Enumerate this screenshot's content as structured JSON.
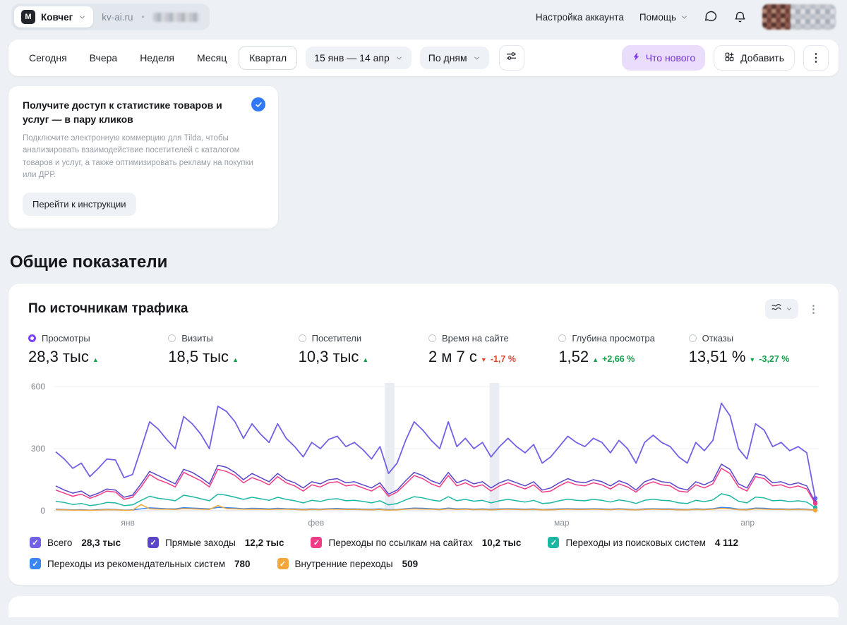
{
  "header": {
    "counter_name": "Ковчег",
    "site_domain": "kv-ai.ru",
    "separator": "•",
    "account_settings_label": "Настройка аккаунта",
    "help_label": "Помощь"
  },
  "glyphs": {
    "kebab": "⋮",
    "check": "✓"
  },
  "toolbar": {
    "periods": [
      "Сегодня",
      "Вчера",
      "Неделя",
      "Месяц",
      "Квартал"
    ],
    "selected_period": "Квартал",
    "date_range_label": "15 янв — 14 апр",
    "granularity_label": "По дням",
    "whats_new_label": "Что нового",
    "add_label": "Добавить"
  },
  "promo": {
    "title": "Получите доступ к статистике товаров и услуг — в пару кликов",
    "body": "Подключите электронную коммерцию для Tilda, чтобы анализировать взаимодействие посетителей с каталогом товаров и услуг, а также оптимизировать рекламу на покупки или ДРР.",
    "action_label": "Перейти к инструкции"
  },
  "section_title": "Общие показатели",
  "chart_card": {
    "title": "По источникам трафика",
    "metrics": [
      {
        "label": "Просмотры",
        "value": "28,3 тыс",
        "trend": "up",
        "trend_color": "green",
        "delta": "",
        "selected": true
      },
      {
        "label": "Визиты",
        "value": "18,5 тыс",
        "trend": "up",
        "trend_color": "green",
        "delta": ""
      },
      {
        "label": "Посетители",
        "value": "10,3 тыс",
        "trend": "up",
        "trend_color": "green",
        "delta": ""
      },
      {
        "label": "Время на сайте",
        "value": "2 м 7 с",
        "trend": "down",
        "trend_color": "red",
        "delta": "-1,7 %"
      },
      {
        "label": "Глубина просмотра",
        "value": "1,52",
        "trend": "up",
        "trend_color": "green",
        "delta": "+2,66 %"
      },
      {
        "label": "Отказы",
        "value": "13,51 %",
        "trend": "down",
        "trend_color": "green",
        "delta": "-3,27 %"
      }
    ],
    "legend": [
      {
        "label": "Всего",
        "value": "28,3 тыс"
      },
      {
        "label": "Прямые заходы",
        "value": "12,2 тыс"
      },
      {
        "label": "Переходы по ссылкам на сайтах",
        "value": "10,2 тыс"
      },
      {
        "label": "Переходы из поисковых систем",
        "value": "4 112"
      },
      {
        "label": "Переходы из рекомендательных систем",
        "value": "780"
      },
      {
        "label": "Внутренние переходы",
        "value": "509"
      }
    ]
  },
  "chart_data": {
    "type": "line",
    "title": "По источникам трафика",
    "metric_shown": "Просмотры",
    "date_range": "15 янв — 14 апр",
    "granularity": "По дням",
    "y_axis": {
      "ticks": [
        0,
        300,
        600
      ],
      "max": 600
    },
    "x_axis": {
      "ticks": [
        "янв",
        "фев",
        "мар",
        "апр"
      ],
      "tick_fractions": [
        0.097,
        0.343,
        0.664,
        0.907
      ]
    },
    "highlight_band_fractions": [
      0.439,
      0.576
    ],
    "series": [
      {
        "name": "Всего",
        "total": "28,3 тыс",
        "color": "#7161e6",
        "values": [
          285,
          250,
          205,
          230,
          165,
          205,
          250,
          245,
          160,
          175,
          300,
          430,
          395,
          345,
          300,
          455,
          420,
          370,
          300,
          505,
          480,
          430,
          350,
          420,
          370,
          330,
          420,
          350,
          310,
          260,
          330,
          300,
          345,
          360,
          310,
          330,
          295,
          250,
          310,
          180,
          230,
          340,
          430,
          390,
          340,
          300,
          430,
          310,
          350,
          300,
          330,
          260,
          310,
          350,
          310,
          280,
          320,
          230,
          260,
          310,
          360,
          330,
          310,
          350,
          330,
          280,
          340,
          300,
          230,
          330,
          365,
          330,
          310,
          260,
          230,
          330,
          290,
          340,
          520,
          460,
          300,
          250,
          420,
          390,
          310,
          330,
          290,
          310,
          280,
          60
        ]
      },
      {
        "name": "Прямые заходы",
        "total": "12,2 тыс",
        "color": "#5b45c9",
        "values": [
          120,
          100,
          85,
          95,
          70,
          85,
          105,
          100,
          65,
          75,
          130,
          190,
          170,
          150,
          130,
          200,
          185,
          160,
          130,
          220,
          210,
          185,
          150,
          180,
          160,
          140,
          180,
          150,
          135,
          110,
          140,
          130,
          150,
          155,
          135,
          140,
          125,
          110,
          135,
          80,
          100,
          145,
          185,
          170,
          145,
          130,
          185,
          135,
          150,
          130,
          140,
          110,
          135,
          150,
          135,
          120,
          140,
          100,
          110,
          135,
          155,
          140,
          135,
          150,
          140,
          120,
          145,
          130,
          100,
          140,
          155,
          140,
          135,
          110,
          100,
          140,
          125,
          145,
          225,
          200,
          130,
          110,
          180,
          170,
          135,
          140,
          125,
          135,
          120,
          40
        ]
      },
      {
        "name": "Переходы по ссылкам на сайтах",
        "total": "10,2 тыс",
        "color": "#f13c87",
        "values": [
          100,
          85,
          70,
          80,
          60,
          75,
          95,
          90,
          55,
          65,
          115,
          175,
          150,
          135,
          115,
          185,
          165,
          145,
          115,
          200,
          190,
          170,
          135,
          160,
          145,
          125,
          165,
          135,
          120,
          95,
          125,
          115,
          135,
          140,
          120,
          125,
          110,
          95,
          120,
          70,
          90,
          130,
          170,
          155,
          130,
          115,
          170,
          120,
          135,
          115,
          125,
          95,
          120,
          135,
          120,
          105,
          125,
          90,
          95,
          120,
          140,
          125,
          120,
          135,
          125,
          105,
          130,
          115,
          90,
          125,
          140,
          125,
          120,
          95,
          90,
          125,
          110,
          130,
          205,
          180,
          115,
          95,
          165,
          155,
          120,
          125,
          110,
          120,
          105,
          35
        ]
      },
      {
        "name": "Переходы из поисковых систем",
        "total": "4 112",
        "color": "#1db8a3",
        "values": [
          45,
          40,
          30,
          35,
          25,
          30,
          40,
          38,
          25,
          28,
          50,
          70,
          60,
          55,
          48,
          75,
          68,
          58,
          48,
          80,
          75,
          65,
          55,
          65,
          58,
          50,
          65,
          55,
          48,
          38,
          50,
          45,
          55,
          58,
          48,
          50,
          45,
          38,
          48,
          28,
          35,
          52,
          68,
          62,
          52,
          46,
          68,
          48,
          55,
          46,
          50,
          38,
          48,
          55,
          48,
          42,
          50,
          35,
          38,
          48,
          56,
          50,
          48,
          55,
          50,
          42,
          52,
          46,
          35,
          50,
          56,
          50,
          48,
          38,
          35,
          50,
          44,
          52,
          82,
          72,
          46,
          38,
          66,
          62,
          48,
          50,
          44,
          48,
          42,
          15
        ]
      },
      {
        "name": "Переходы из рекомендательных систем",
        "total": "780",
        "color": "#3a87f2",
        "values": [
          8,
          6,
          4,
          5,
          3,
          5,
          7,
          6,
          3,
          4,
          9,
          14,
          12,
          10,
          9,
          15,
          13,
          11,
          9,
          16,
          15,
          13,
          10,
          12,
          11,
          9,
          12,
          10,
          9,
          7,
          9,
          8,
          10,
          11,
          9,
          9,
          8,
          7,
          9,
          5,
          6,
          10,
          13,
          12,
          10,
          8,
          13,
          9,
          10,
          8,
          9,
          7,
          9,
          10,
          9,
          8,
          9,
          6,
          7,
          9,
          10,
          9,
          9,
          10,
          9,
          8,
          10,
          8,
          6,
          9,
          10,
          9,
          9,
          7,
          6,
          9,
          8,
          10,
          16,
          14,
          8,
          7,
          13,
          12,
          9,
          9,
          8,
          9,
          8,
          3
        ]
      },
      {
        "name": "Внутренние переходы",
        "total": "509",
        "color": "#f3a73a",
        "values": [
          5,
          4,
          3,
          3,
          2,
          3,
          5,
          4,
          2,
          3,
          30,
          9,
          8,
          7,
          6,
          10,
          9,
          7,
          6,
          25,
          10,
          9,
          7,
          8,
          7,
          6,
          8,
          7,
          6,
          4,
          6,
          5,
          7,
          7,
          6,
          6,
          5,
          4,
          6,
          3,
          4,
          7,
          9,
          8,
          7,
          5,
          9,
          6,
          7,
          5,
          6,
          4,
          6,
          7,
          6,
          5,
          6,
          4,
          4,
          6,
          7,
          6,
          6,
          7,
          6,
          5,
          7,
          5,
          4,
          6,
          7,
          6,
          6,
          4,
          4,
          6,
          5,
          7,
          11,
          9,
          5,
          4,
          9,
          8,
          6,
          6,
          5,
          6,
          5,
          2
        ]
      }
    ]
  }
}
